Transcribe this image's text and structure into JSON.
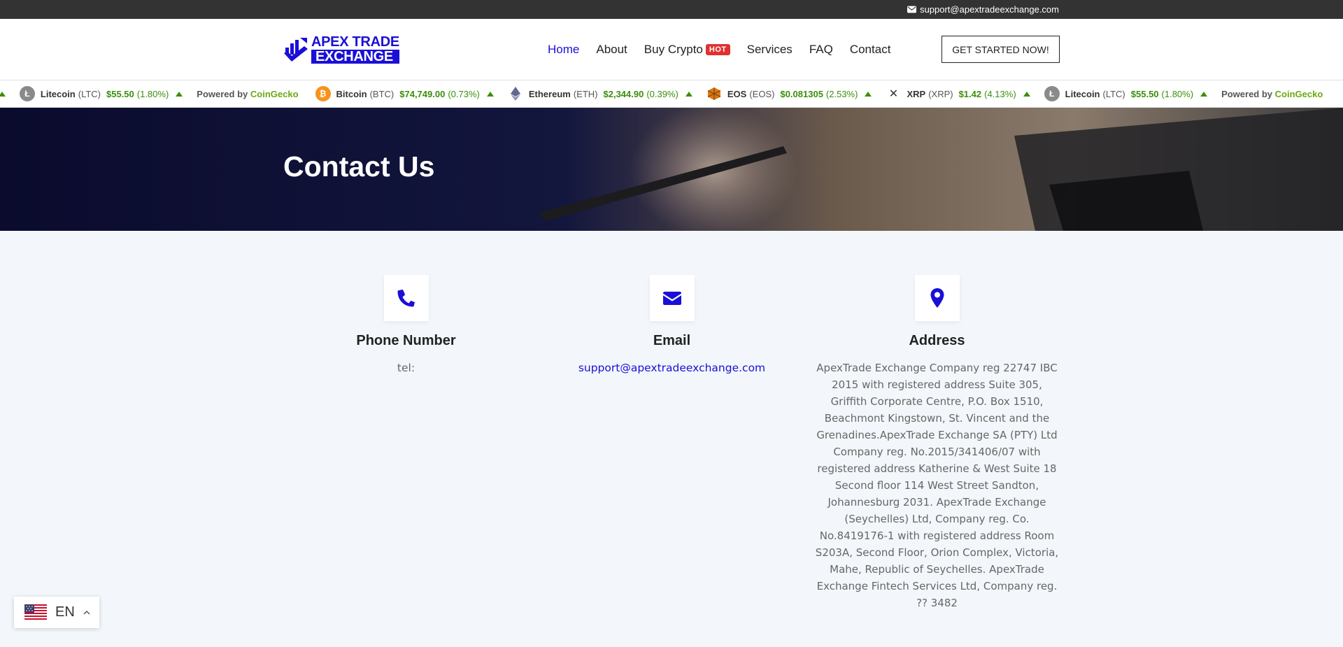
{
  "topbar": {
    "email": "support@apextradeexchange.com"
  },
  "logo": {
    "line1": "APEX TRADE",
    "line2": "EXCHANGE"
  },
  "nav": {
    "items": [
      {
        "label": "Home",
        "active": true
      },
      {
        "label": "About"
      },
      {
        "label": "Buy Crypto",
        "badge": "HOT"
      },
      {
        "label": "Services"
      },
      {
        "label": "FAQ"
      },
      {
        "label": "Contact"
      }
    ],
    "cta": "GET STARTED NOW!"
  },
  "ticker": {
    "powered_prefix": "Powered by",
    "powered_brand": "CoinGecko",
    "lead_change": "%)",
    "coins": [
      {
        "name": "Litecoin",
        "symbol": "(LTC)",
        "price": "$55.50",
        "change": "(1.80%)",
        "color": "#8a8a8a",
        "icon": "litecoin-icon"
      },
      {
        "name": "Bitcoin",
        "symbol": "(BTC)",
        "price": "$74,749.00",
        "change": "(0.73%)",
        "color": "#f7931a",
        "icon": "bitcoin-icon"
      },
      {
        "name": "Ethereum",
        "symbol": "(ETH)",
        "price": "$2,344.90",
        "change": "(0.39%)",
        "color": "#62688f",
        "icon": "ethereum-icon"
      },
      {
        "name": "EOS",
        "symbol": "(EOS)",
        "price": "$0.081305",
        "change": "(2.53%)",
        "color": "#d97a17",
        "icon": "eos-icon"
      },
      {
        "name": "XRP",
        "symbol": "(XRP)",
        "price": "$1.42",
        "change": "(4.13%)",
        "color": "#333333",
        "icon": "xrp-icon"
      },
      {
        "name": "Litecoin",
        "symbol": "(LTC)",
        "price": "$55.50",
        "change": "(1.80%)",
        "color": "#8a8a8a",
        "icon": "litecoin-icon"
      }
    ]
  },
  "hero": {
    "title": "Contact Us"
  },
  "contact": {
    "phone": {
      "title": "Phone Number",
      "text": "tel:",
      "icon": "phone-icon"
    },
    "email": {
      "title": "Email",
      "text": "support@apextradeexchange.com",
      "icon": "envelope-icon"
    },
    "address": {
      "title": "Address",
      "icon": "map-pin-icon",
      "text": "ApexTrade Exchange Company reg 22747 IBC 2015 with registered address Suite 305, Griffith Corporate Centre, P.O. Box 1510, Beachmont Kingstown, St. Vincent and the Grenadines.ApexTrade Exchange SA (PTY) Ltd Company reg. No.2015/341406/07 with registered address Katherine & West Suite 18 Second floor 114 West Street Sandton, Johannesburg 2031. ApexTrade Exchange (Seychelles) Ltd, Company reg. Co. No.8419176-1 with registered address Room S203A, Second Floor, Orion Complex, Victoria, Mahe, Republic of Seychelles. ApexTrade Exchange Fintech Services Ltd, Company reg. ?? 3482"
    }
  },
  "language": {
    "code": "EN",
    "icon": "us-flag-icon"
  },
  "colors": {
    "brand": "#1a0fd6",
    "topbar": "#333333",
    "hot": "#e03131",
    "ticker_up": "#3a8f0a",
    "background": "#f3f7fb"
  }
}
